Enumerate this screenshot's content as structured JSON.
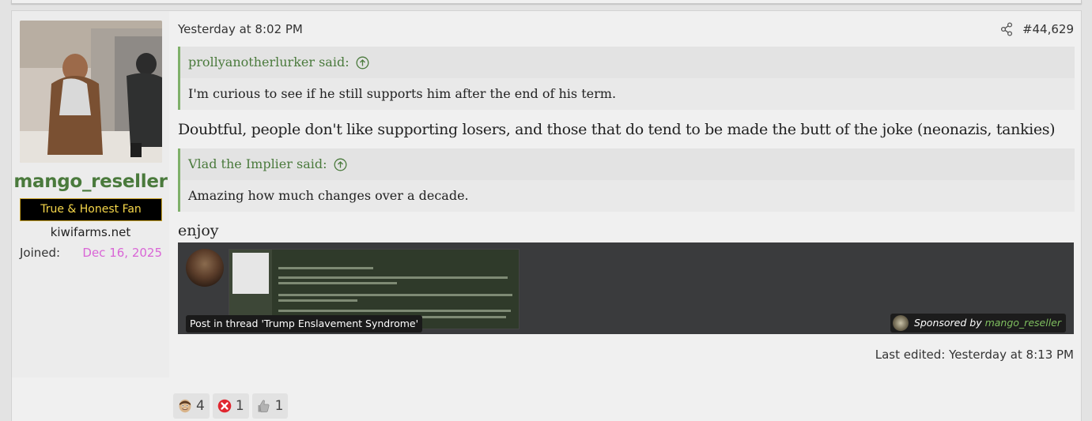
{
  "post": {
    "date": "Yesterday at 8:02 PM",
    "number": "#44,629",
    "last_edited": "Last edited: Yesterday at 8:13 PM",
    "quotes": [
      {
        "author": "prollyanotherlurker said:",
        "text": "I'm curious to see if he still supports him after the end of his term."
      },
      {
        "author": "Vlad the Implier said:",
        "text": "Amazing how much changes over a decade."
      }
    ],
    "text1": "Doubtful, people don't like supporting losers, and those that do tend to be made the butt of the joke (neonazis, tankies)",
    "text2": "enjoy",
    "embed": {
      "caption": "Post in thread 'Trump Enslavement Syndrome'",
      "sponsored_prefix": "Sponsored by",
      "sponsored_name": "mango_reseller"
    }
  },
  "user": {
    "name": "mango_reseller",
    "title": "True & Honest Fan",
    "site": "kiwifarms.net",
    "joined_label": "Joined:",
    "joined_value": "Dec 16, 2025"
  },
  "reactions": [
    {
      "icon": "face-emoji-icon",
      "count": "4"
    },
    {
      "icon": "red-x-icon",
      "count": "1"
    },
    {
      "icon": "thumbs-up-icon",
      "count": "1"
    }
  ],
  "colors": {
    "username": "#4a7a3c",
    "quote_accent": "#7fb06a",
    "joined_date": "#d966d6",
    "user_title_text": "#f6d74a"
  }
}
